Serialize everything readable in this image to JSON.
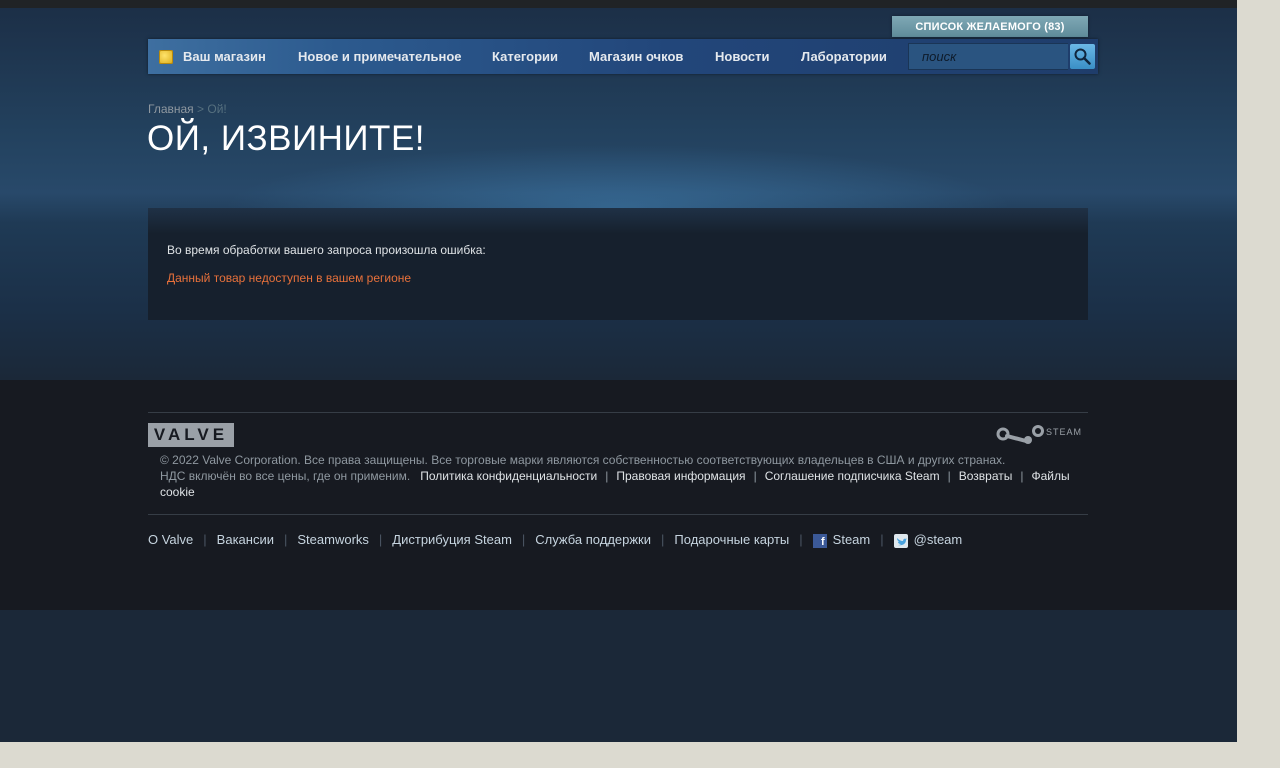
{
  "wishlist_label": "СПИСОК ЖЕЛАЕМОГО (83)",
  "nav": {
    "items": [
      "Ваш магазин",
      "Новое и примечательное",
      "Категории",
      "Магазин очков",
      "Новости",
      "Лаборатории"
    ],
    "search_placeholder": "поиск"
  },
  "breadcrumb": {
    "home": "Главная",
    "separator": ">",
    "current": "Ой!"
  },
  "page_title": "ОЙ, ИЗВИНИТЕ!",
  "error": {
    "intro": "Во время обработки вашего запроса произошла ошибка:",
    "message": "Данный товар недоступен в вашем регионе",
    "message_color": "#e8713b"
  },
  "footer": {
    "valve_logo": "VALVE",
    "steam_logo": "STEAM",
    "copyright": "© 2022 Valve Corporation. Все права защищены. Все торговые марки являются собственностью соответствующих владельцев в США и других странах.",
    "vat": "НДС включён во все цены, где он применим.",
    "legal_links": [
      "Политика конфиденциальности",
      "Правовая информация",
      "Соглашение подписчика Steam",
      "Возвраты",
      "Файлы cookie"
    ],
    "links": [
      "О Valve",
      "Вакансии",
      "Steamworks",
      "Дистрибуция Steam",
      "Служба поддержки",
      "Подарочные карты",
      "Steam",
      "@steam"
    ],
    "social_icons": [
      "facebook-icon",
      "twitter-icon"
    ]
  },
  "colors": {
    "background": "#1b2838",
    "footer": "#171a21",
    "accent": "#66c0f4"
  }
}
